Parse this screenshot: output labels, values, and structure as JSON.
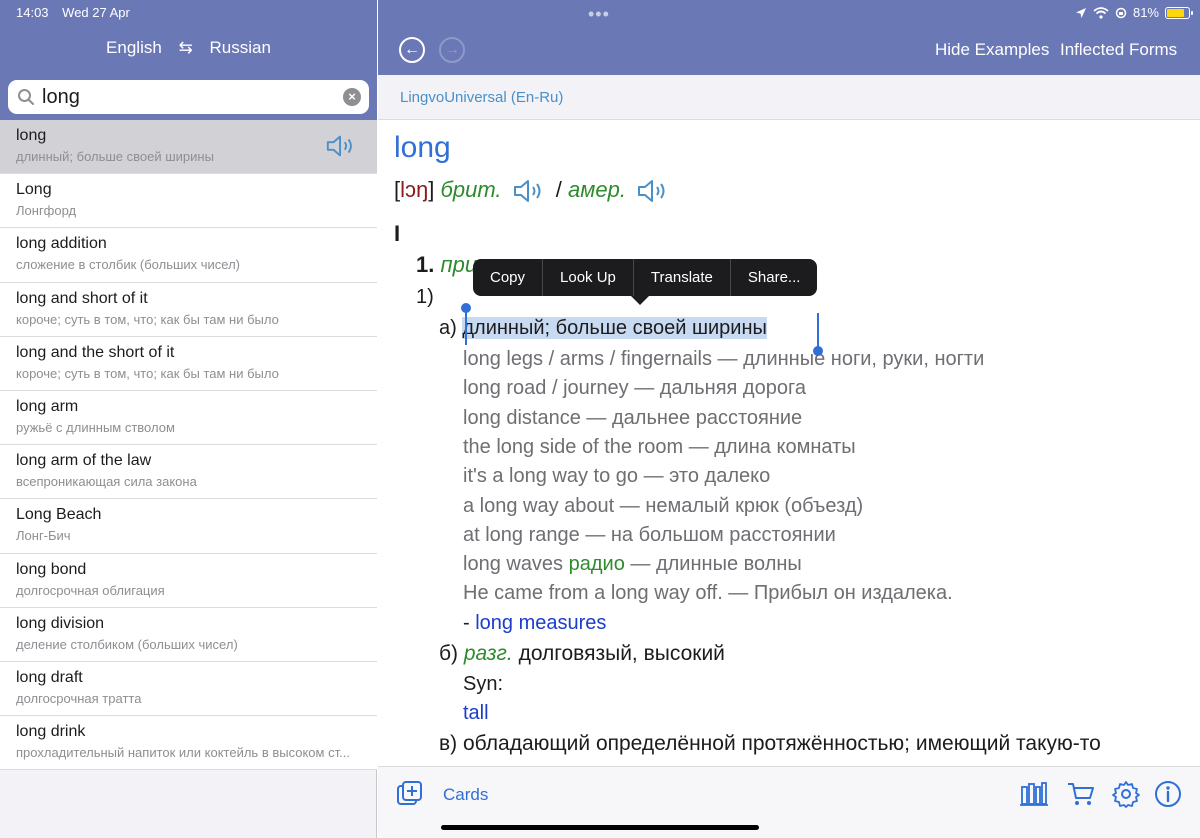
{
  "status": {
    "time": "14:03",
    "date": "Wed 27 Apr",
    "battery": "81%",
    "battery_level": 0.81
  },
  "left_header": {
    "source_lang": "English",
    "target_lang": "Russian"
  },
  "search": {
    "value": "long"
  },
  "results": [
    {
      "title": "long",
      "sub": "длинный; больше своей ширины",
      "selected": true
    },
    {
      "title": "Long",
      "sub": "Лонгфорд"
    },
    {
      "title": "long addition",
      "sub": "сложение в столбик (больших чисел)"
    },
    {
      "title": "long and short of it",
      "sub": "короче; суть в том, что; как бы там ни было"
    },
    {
      "title": "long and the short of it",
      "sub": "короче; суть в том, что; как бы там ни было"
    },
    {
      "title": "long arm",
      "sub": "ружьё с длинным стволом"
    },
    {
      "title": "long arm of the law",
      "sub": "всепроникающая сила закона"
    },
    {
      "title": "Long Beach",
      "sub": "Лонг-Бич"
    },
    {
      "title": "long bond",
      "sub": "долгосрочная облигация"
    },
    {
      "title": "long division",
      "sub": "деление столбиком (больших чисел)"
    },
    {
      "title": "long draft",
      "sub": "долгосрочная тратта"
    },
    {
      "title": "long drink",
      "sub": "прохладительный напиток или коктейль в высоком ст..."
    }
  ],
  "right_header": {
    "hide_examples": "Hide Examples",
    "inflected_forms": "Inflected Forms"
  },
  "dictionary_name": "LingvoUniversal (En-Ru)",
  "article": {
    "headword": "long",
    "ipa_open": "[",
    "ipa": "lɔŋ",
    "ipa_close": "]",
    "brit": "брит.",
    "slash": "/",
    "amer": "амер.",
    "roman": "I",
    "sense_num": "1.",
    "sense_pos": "при",
    "sub_num": "1)",
    "a_label": "а)",
    "a_text": "длинный; больше своей ширины",
    "examples": [
      "long legs / arms / fingernails — длинные ноги, руки, ногти",
      "long road / journey — дальняя дорога",
      "long distance — дальнее расстояние",
      "the long side of the room — длина комнаты",
      "it's a long way to go — это далеко",
      "a long way about — немалый крюк (объезд)",
      "at long range — на большом расстоянии"
    ],
    "waves_a": "long waves",
    "waves_label": "радио",
    "waves_b": "— длинные волны",
    "came_from": "He came from a long way off. — Прибыл он издалека.",
    "measures_dash": "-",
    "measures_link": "long measures",
    "b_label": "б)",
    "b_style": "разг.",
    "b_text": "долговязый, высокий",
    "syn": "Syn:",
    "syn_link": "tall",
    "v_label": "в)",
    "v_text": "обладающий определённой протяжённостью; имеющий такую-то"
  },
  "context_menu": [
    "Copy",
    "Look Up",
    "Translate",
    "Share..."
  ],
  "bottom": {
    "cards_label": "Cards"
  },
  "icons": {
    "search": "magnifier-icon",
    "clear": "clear-icon",
    "speaker": "speaker-icon",
    "swap": "swap-arrows-icon",
    "back": "back-arrow-icon",
    "forward": "forward-arrow-icon",
    "cards": "add-card-icon",
    "library": "library-icon",
    "cart": "cart-icon",
    "settings": "gear-icon",
    "info": "info-icon"
  },
  "colors": {
    "header": "#6a78b6",
    "accent": "#2f6fd6",
    "green": "#2e8b2e",
    "link": "#1a3dcc",
    "battery": "#ffd60a"
  }
}
